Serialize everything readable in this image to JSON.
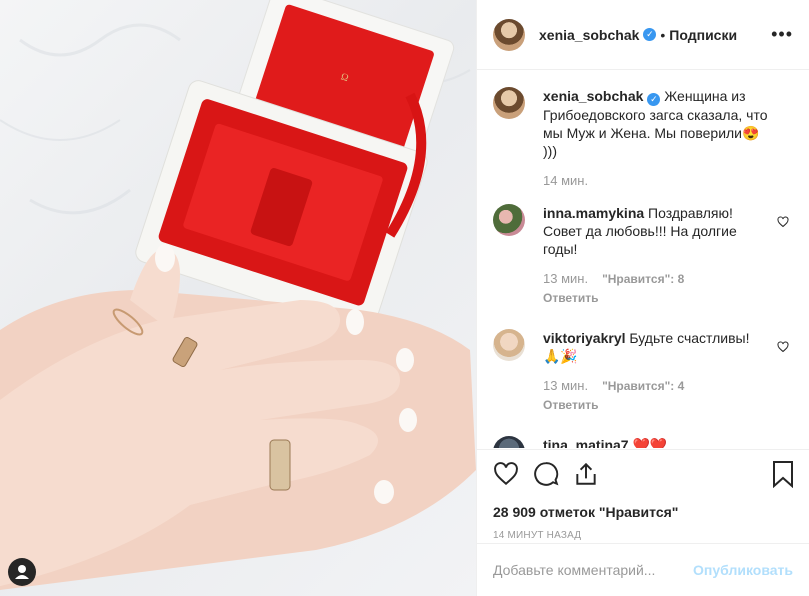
{
  "header": {
    "username": "xenia_sobchak",
    "separator": "•",
    "follow_label": "Подписки",
    "more_label": "•••"
  },
  "post": {
    "author": "xenia_sobchak",
    "caption": "Женщина из Грибоедовского загса сказала, что мы Муж и Жена. Мы поверили😍 )))",
    "time": "14 мин."
  },
  "comments": [
    {
      "user": "inna.mamykina",
      "text": "Поздравляю! Совет да любовь!!! На долгие годы!",
      "time": "13 мин.",
      "likes": "\"Нравится\": 8",
      "reply": "Ответить"
    },
    {
      "user": "viktoriyakryl",
      "text": "Будьте счастливы! 🙏🎉",
      "time": "13 мин.",
      "likes": "\"Нравится\": 4",
      "reply": "Ответить"
    },
    {
      "user": "tina_matina7",
      "text": "❤️❤️"
    }
  ],
  "actions": {
    "likes_count": "28 909 отметок \"Нравится\"",
    "timestamp": "14 МИНУТ НАЗАД"
  },
  "comment_box": {
    "placeholder": "Добавьте комментарий...",
    "publish_label": "Опубликовать"
  },
  "icons": {
    "like": "heart-icon",
    "comment": "comment-icon",
    "share": "share-icon",
    "save": "bookmark-icon",
    "user_tag": "user-tag-icon"
  },
  "colors": {
    "verified": "#3897f0",
    "publish": "#b2dffc",
    "box_red": "#e01b1b"
  }
}
